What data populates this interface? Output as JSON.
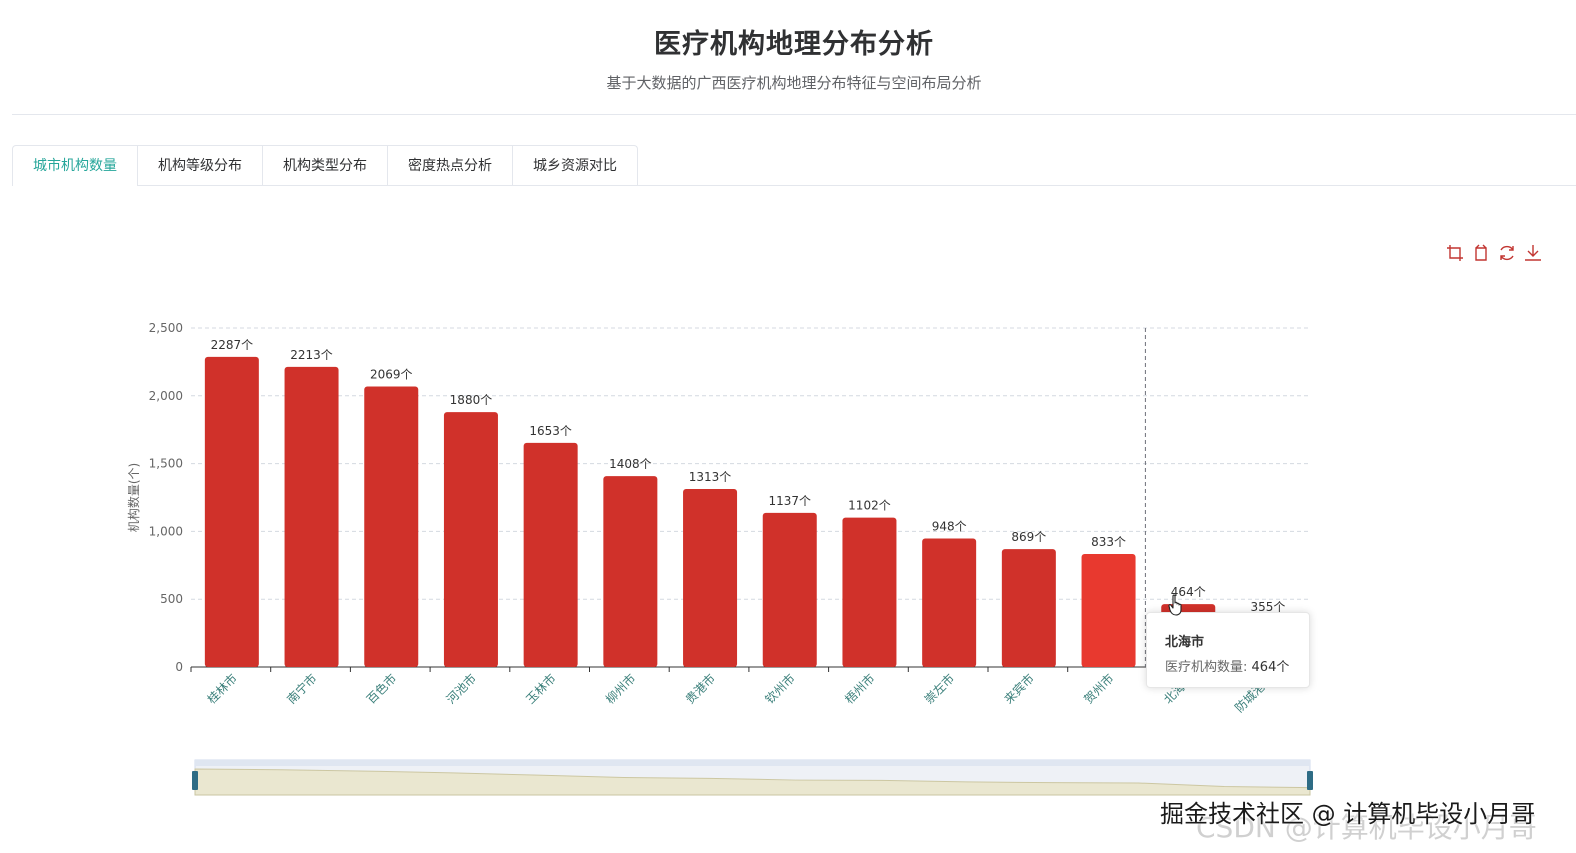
{
  "page": {
    "title": "医疗机构地理分布分析",
    "subtitle": "基于大数据的广西医疗机构地理分布特征与空间布局分析"
  },
  "tabs": [
    {
      "label": "城市机构数量",
      "active": true
    },
    {
      "label": "机构等级分布",
      "active": false
    },
    {
      "label": "机构类型分布",
      "active": false
    },
    {
      "label": "密度热点分析",
      "active": false
    },
    {
      "label": "城乡资源对比",
      "active": false
    }
  ],
  "toolbox": [
    "zoom-icon",
    "zoom-reset-icon",
    "restore-icon",
    "download-icon"
  ],
  "colors": {
    "accent": "#26a69a",
    "bar": "#d0312a",
    "bar_highlight": "#e8392f",
    "tool": "#c23531"
  },
  "chart_data": {
    "type": "bar",
    "title": "",
    "xlabel": "",
    "ylabel": "机构数量(个)",
    "ylim": [
      0,
      2500
    ],
    "yticks": [
      "0",
      "500",
      "1,000",
      "1,500",
      "2,000",
      "2,500"
    ],
    "ytick_values": [
      0,
      500,
      1000,
      1500,
      2000,
      2500
    ],
    "grid": true,
    "categories": [
      "桂林市",
      "南宁市",
      "百色市",
      "河池市",
      "玉林市",
      "柳州市",
      "贵港市",
      "钦州市",
      "梧州市",
      "崇左市",
      "来宾市",
      "贺州市",
      "北海市",
      "防城港市"
    ],
    "values": [
      2287,
      2213,
      2069,
      1880,
      1653,
      1408,
      1313,
      1137,
      1102,
      948,
      869,
      833,
      464,
      355
    ],
    "value_labels": [
      "2287个",
      "2213个",
      "2069个",
      "1880个",
      "1653个",
      "1408个",
      "1313个",
      "1137个",
      "1102个",
      "948个",
      "869个",
      "833个",
      "464个",
      "355个"
    ],
    "highlight_index": 11,
    "pointer_index": 11
  },
  "tooltip": {
    "title": "北海市",
    "label": "医疗机构数量",
    "value": "464个"
  },
  "watermark": {
    "primary": "掘金技术社区 @ 计算机毕设小月哥",
    "secondary": "CSDN @计算机毕设小月哥"
  }
}
